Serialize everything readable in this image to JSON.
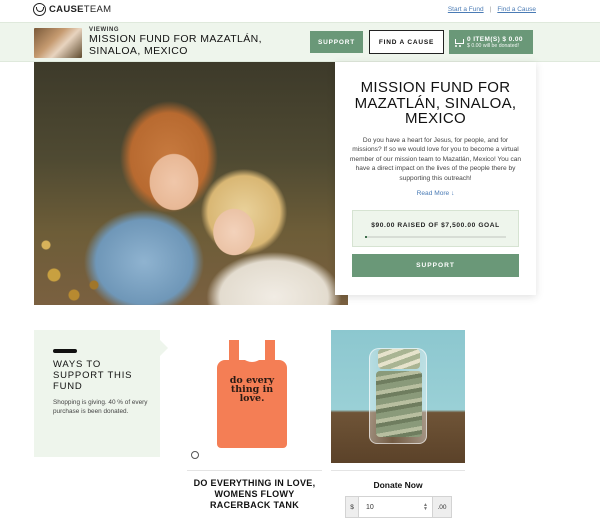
{
  "header": {
    "logo_bold": "CAUSE",
    "logo_light": "TEAM",
    "links": [
      "Start a Fund",
      "Find a Cause"
    ],
    "link_separator": "|"
  },
  "fund_band": {
    "viewing_label": "VIEWING",
    "title": "MISSION FUND FOR MAZATLÁN, SINALOA, MEXICO",
    "support_button": "SUPPORT",
    "find_cause_button": "FIND A CAUSE",
    "cart_count": "0 ITEM(S) $ 0.00",
    "cart_donated": "$ 0.00 will be donated!"
  },
  "hero": {
    "title": "MISSION FUND FOR MAZATLÁN, SINALOA, MEXICO",
    "description": "Do you have a heart for Jesus, for people, and for missions? If so we would love for you to become a virtual member of our mission team to Mazatlán, Mexico! You can have a direct impact on the lives of the people there by supporting this outreach!",
    "read_more": "Read More",
    "goal_text": "$90.00 RAISED OF $7,500.00 GOAL",
    "goal_progress_percent": 1.2,
    "support_button": "SUPPORT"
  },
  "ways": {
    "title": "WAYS TO SUPPORT THIS FUND",
    "description": "Shopping is giving. 40 % of every purchase is been donated."
  },
  "product": {
    "name": "DO EVERYTHING IN LOVE, WOMENS FLOWY RACERBACK TANK",
    "shirt_text": "do every thing in love."
  },
  "donate": {
    "title": "Donate Now",
    "currency_prefix": "$",
    "amount": "10",
    "cents_suffix": ".00"
  },
  "colors": {
    "accent_green": "#6a9878",
    "band_bg": "#eef5ec",
    "link_blue": "#4a7bb5",
    "shirt_orange": "#f47e55"
  }
}
